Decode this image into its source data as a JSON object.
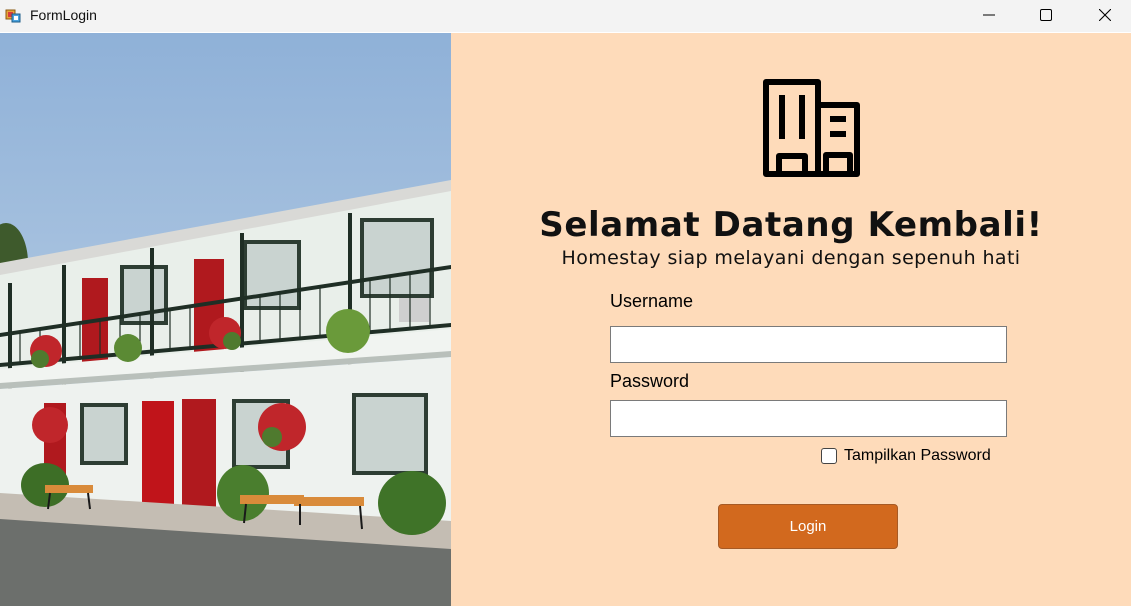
{
  "window": {
    "title": "FormLogin",
    "icon": "winforms-app-icon",
    "controls": [
      "minimize-icon",
      "maximize-icon",
      "close-icon"
    ]
  },
  "photo": {
    "subject": "two-storey motel building with red doors, balconies and hanging flower baskets"
  },
  "login": {
    "logo_icon": "building-icon",
    "heading": "Selamat Datang Kembali!",
    "subheading": "Homestay siap melayani dengan sepenuh hati",
    "username_label": "Username",
    "username_value": "",
    "password_label": "Password",
    "password_value": "",
    "show_password_label": "Tampilkan Password",
    "show_password_checked": false,
    "submit_label": "Login"
  },
  "colors": {
    "panel_background": "#fedbba",
    "button_background": "#d2691e",
    "button_text": "#ffffff",
    "titlebar_background": "#f3f3f3"
  }
}
